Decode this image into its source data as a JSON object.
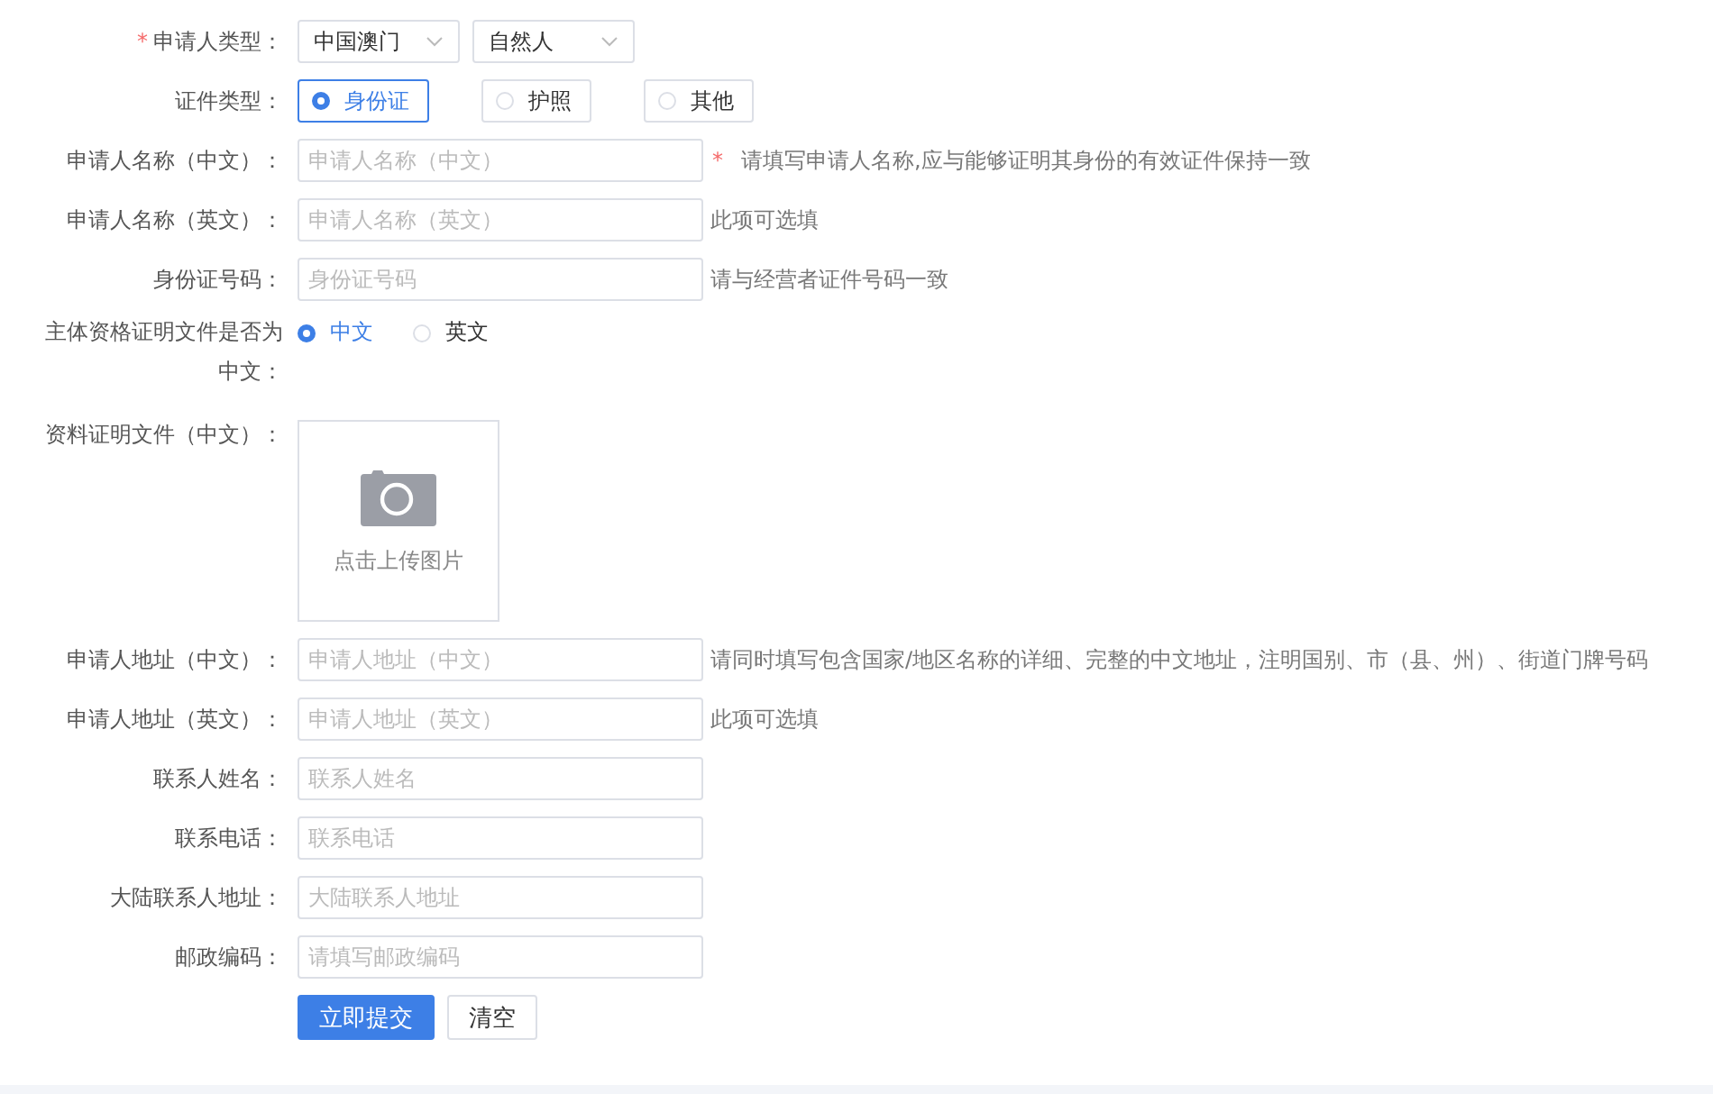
{
  "rows": [
    {
      "kind": "select",
      "label_mark": "*",
      "label": "申请人类型：",
      "selects": [
        "中国澳门",
        "自然人"
      ]
    },
    {
      "kind": "radio_boxed",
      "label": "证件类型：",
      "options": [
        {
          "label": "身份证",
          "selected": true
        },
        {
          "label": "护照",
          "selected": false
        },
        {
          "label": "其他",
          "selected": false
        }
      ]
    },
    {
      "kind": "text",
      "label": "申请人名称（中文）：",
      "placeholder": "申请人名称（中文）",
      "hint_mark": "*",
      "hint": "请填写申请人名称,应与能够证明其身份的有效证件保持一致"
    },
    {
      "kind": "text",
      "label": "申请人名称（英文）：",
      "placeholder": "申请人名称（英文）",
      "hint": "此项可选填"
    },
    {
      "kind": "text",
      "label": "身份证号码：",
      "placeholder": "身份证号码",
      "hint": "请与经营者证件号码一致"
    },
    {
      "kind": "radio",
      "label": "主体资格证明文件是否为中文：",
      "options": [
        {
          "label": "中文",
          "selected": true
        },
        {
          "label": "英文",
          "selected": false
        }
      ]
    },
    {
      "kind": "upload",
      "label": "资料证明文件（中文）：",
      "upload_text": "点击上传图片"
    },
    {
      "kind": "text",
      "label": "申请人地址（中文）：",
      "placeholder": "申请人地址（中文）",
      "hint": "请同时填写包含国家/地区名称的详细、完整的中文地址，注明国别、市（县、州）、街道门牌号码"
    },
    {
      "kind": "text",
      "label": "申请人地址（英文）：",
      "placeholder": "申请人地址（英文）",
      "hint": "此项可选填"
    },
    {
      "kind": "text",
      "label": "联系人姓名：",
      "placeholder": "联系人姓名"
    },
    {
      "kind": "text",
      "label": "联系电话：",
      "placeholder": "联系电话"
    },
    {
      "kind": "text",
      "label": "大陆联系人地址：",
      "placeholder": "大陆联系人地址"
    },
    {
      "kind": "text",
      "label": "邮政编码：",
      "placeholder": "请填写邮政编码"
    }
  ],
  "buttons": [
    {
      "label": "立即提交",
      "kind": "primary"
    },
    {
      "label": "清空",
      "kind": "default"
    }
  ]
}
